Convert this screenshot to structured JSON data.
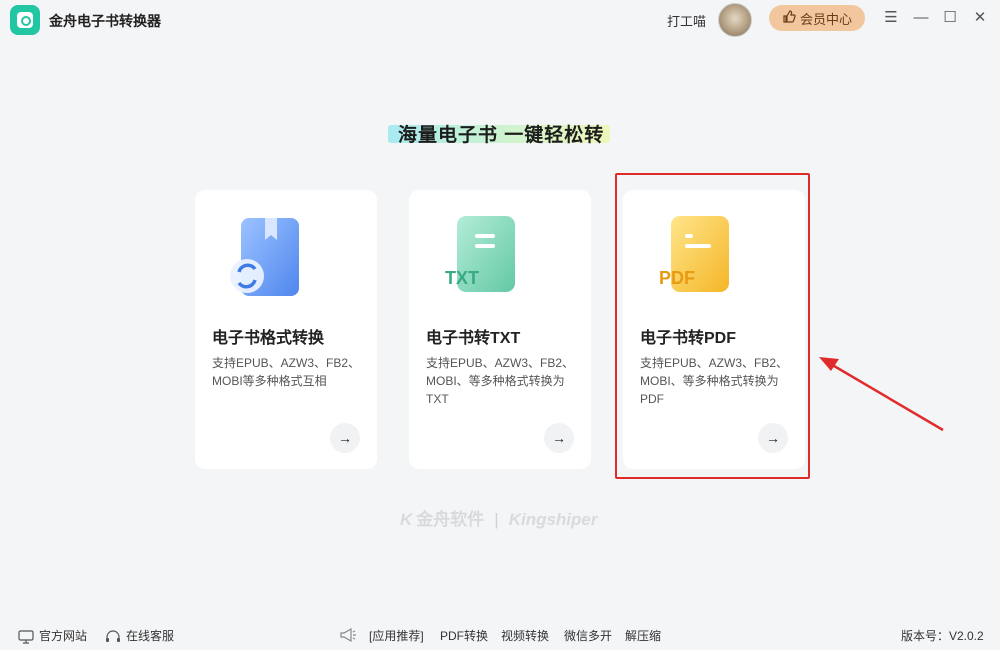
{
  "app": {
    "title": "金舟电子书转换器"
  },
  "user": {
    "name": "打工喵"
  },
  "header": {
    "vip_label": "会员中心",
    "menu_icon": "menu-icon",
    "minimize_icon": "minimize-icon",
    "maximize_icon": "maximize-icon",
    "close_icon": "close-icon"
  },
  "slogan": "海量电子书  一键轻松转",
  "cards": [
    {
      "title": "电子书格式转换",
      "desc": "支持EPUB、AZW3、FB2、MOBI等多种格式互相",
      "icon": "book-convert-icon",
      "color": "#6f9ff5"
    },
    {
      "title": "电子书转TXT",
      "desc": "支持EPUB、AZW3、FB2、MOBI、等多种格式转换为TXT",
      "icon": "txt-file-icon",
      "color": "#7fd6b6",
      "badge": "TXT"
    },
    {
      "title": "电子书转PDF",
      "desc": "支持EPUB、AZW3、FB2、MOBI、等多种格式转换为PDF",
      "icon": "pdf-file-icon",
      "color": "#f6c443",
      "badge": "PDF"
    }
  ],
  "card_arrow": "→",
  "brand": {
    "cn": "金舟软件",
    "sep": "|",
    "en": "Kingshiper"
  },
  "footer": {
    "website": "官方网站",
    "service": "在线客服",
    "recommend": "[应用推荐]",
    "links": [
      "PDF转换",
      "视频转换",
      "微信多开",
      "解压缩"
    ],
    "version": "版本号：V2.0.2"
  },
  "colors": {
    "accent": "#23c6a3",
    "highlight": "#e02b2b",
    "vip": "#f2c79e"
  }
}
